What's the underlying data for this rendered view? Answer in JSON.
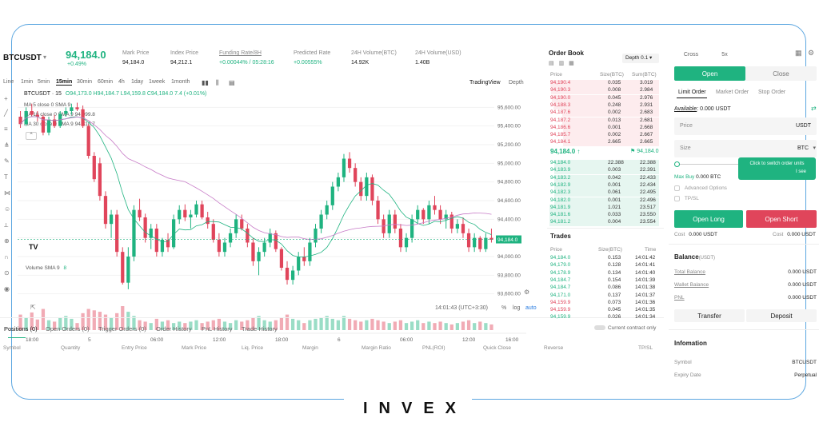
{
  "header": {
    "symbol": "BTCUSDT",
    "last_price": "94,184.0",
    "change_pct": "+0.49%",
    "stats": [
      {
        "label": "Mark Price",
        "value": "94,184.0"
      },
      {
        "label": "Index Price",
        "value": "94,212.1"
      },
      {
        "label": "Funding Rate/8H",
        "value": "+0.00044% / 05:28:16"
      },
      {
        "label": "Predicted Rate",
        "value": "+0.00555%"
      },
      {
        "label": "24H Volume(BTC)",
        "value": "14.92K"
      },
      {
        "label": "24H Volume(USD)",
        "value": "1.40B"
      }
    ]
  },
  "toolbar": {
    "intervals": [
      "Line",
      "1min",
      "5min",
      "15min",
      "30min",
      "60min",
      "4h",
      "1day",
      "1week",
      "1month"
    ],
    "active_interval": "15min",
    "view_tradingview": "TradingView",
    "view_depth": "Depth"
  },
  "chart": {
    "legend_main": "BTCUSDT · 15",
    "ohlc": "O94,173.0 H94,184.7 L94,159.8 C94,184.0 7.4 (+0.01%)",
    "ma_lines": [
      "MA 5 close 0 SMA 9",
      "MA 10 close 0 SMA 9  94,099.8",
      "MA 30 close 0 SMA 9  94,310.7"
    ],
    "price_ticks": [
      "95,600.00",
      "95,400.00",
      "95,200.00",
      "95,000.00",
      "94,800.00",
      "94,600.00",
      "94,400.00",
      "94,200.00",
      "94,000.00",
      "93,800.00",
      "93,600.00"
    ],
    "current_price_tag": "94,184.0",
    "time_ticks": [
      "18:00",
      "5",
      "06:00",
      "12:00",
      "18:00",
      "6",
      "06:00",
      "12:00",
      "16:00"
    ],
    "volume_label": "Volume SMA 9",
    "volume_value": "8",
    "clock": "14:01:43 (UTC+3:30)",
    "scale_pct": "%",
    "scale_log": "log",
    "scale_auto": "auto",
    "tv_logo": "TV",
    "colors": {
      "up": "#1fb380",
      "down": "#e0455b",
      "ma1": "#1fb380",
      "ma2": "#c77bc7"
    }
  },
  "bottom_tabs": {
    "tabs": [
      "Positions (0)",
      "Open Orders (0)",
      "Trigger Orders (0)",
      "Order History",
      "PnL History",
      "Trade History"
    ],
    "current_contract": "Current contract only",
    "columns": [
      "Symbol",
      "Quantity",
      "Entry Price",
      "Mark Price",
      "Liq. Price",
      "Margin",
      "Margin Ratio",
      "PNL(ROI)",
      "Quick Close",
      "Reverse",
      "TP/SL"
    ]
  },
  "order_book": {
    "title": "Order Book",
    "depth": "Depth 0.1",
    "headers": [
      "Price",
      "Size(BTC)",
      "Sum(BTC)"
    ],
    "asks": [
      [
        "94,190.4",
        "0.035",
        "3.019"
      ],
      [
        "94,190.3",
        "0.008",
        "2.984"
      ],
      [
        "94,190.0",
        "0.045",
        "2.976"
      ],
      [
        "94,188.3",
        "0.248",
        "2.931"
      ],
      [
        "94,187.6",
        "0.002",
        "2.683"
      ],
      [
        "94,187.2",
        "0.013",
        "2.681"
      ],
      [
        "94,186.6",
        "0.001",
        "2.668"
      ],
      [
        "94,185.7",
        "0.002",
        "2.667"
      ],
      [
        "94,184.1",
        "2.665",
        "2.665"
      ]
    ],
    "mid_price": "94,184.0 ↑",
    "mark_flag": "⚑ 94,184.0",
    "bids": [
      [
        "94,184.0",
        "22.388",
        "22.388"
      ],
      [
        "94,183.9",
        "0.003",
        "22.391"
      ],
      [
        "94,183.2",
        "0.042",
        "22.433"
      ],
      [
        "94,182.9",
        "0.001",
        "22.434"
      ],
      [
        "94,182.3",
        "0.061",
        "22.495"
      ],
      [
        "94,182.0",
        "0.001",
        "22.496"
      ],
      [
        "94,181.9",
        "1.021",
        "23.517"
      ],
      [
        "94,181.6",
        "0.033",
        "23.550"
      ],
      [
        "94,181.2",
        "0.004",
        "23.554"
      ]
    ]
  },
  "trades": {
    "title": "Trades",
    "headers": [
      "Price",
      "Size(BTC)",
      "Time"
    ],
    "rows": [
      [
        "94,184.0",
        "0.153",
        "14:01:42",
        "up"
      ],
      [
        "94,179.0",
        "0.128",
        "14:01:41",
        "up"
      ],
      [
        "94,178.9",
        "0.134",
        "14:01:40",
        "up"
      ],
      [
        "94,184.7",
        "0.154",
        "14:01:39",
        "up"
      ],
      [
        "94,184.7",
        "0.086",
        "14:01:38",
        "up"
      ],
      [
        "94,171.0",
        "0.137",
        "14:01:37",
        "up"
      ],
      [
        "94,159.9",
        "0.073",
        "14:01:36",
        "down"
      ],
      [
        "94,159.9",
        "0.045",
        "14:01:35",
        "down"
      ],
      [
        "94,159.9",
        "0.026",
        "14:01:34",
        "up"
      ]
    ]
  },
  "trade_panel": {
    "margin_mode": "Cross",
    "leverage": "5x",
    "tab_open": "Open",
    "tab_close": "Close",
    "order_types": [
      "Limit Order",
      "Market Order",
      "Stop Order"
    ],
    "available_label": "Available",
    "available_value": ": 0.000 USDT",
    "price_label": "Price",
    "price_unit": "USDT",
    "size_label": "Size",
    "size_unit": "BTC",
    "tooltip": "Click to switch order units",
    "tooltip_sub": "I see",
    "max_buy": "Max Buy",
    "max_buy_value": "0.000 BTC",
    "advanced_options": "Advanced Options",
    "tpsl": "TP/SL",
    "open_long": "Open Long",
    "open_short": "Open Short",
    "cost_label": "Cost",
    "cost_long": "0.000 USDT",
    "cost_short": "0.000 USDT",
    "colors": {
      "long": "#1fb380",
      "short": "#e0455b"
    }
  },
  "balance": {
    "title": "Balance",
    "unit": "(USDT)",
    "rows": [
      {
        "label": "Total Balance",
        "value": "0.000 USDT"
      },
      {
        "label": "Wallet Balance",
        "value": "0.000 USDT"
      },
      {
        "label": "PNL",
        "value": "0.000 USDT"
      }
    ],
    "transfer": "Transfer",
    "deposit": "Deposit"
  },
  "information": {
    "title": "Infomation",
    "rows": [
      {
        "label": "Symbol",
        "value": "BTCUSDT"
      },
      {
        "label": "Expiry Date",
        "value": "Perpetual"
      }
    ]
  },
  "brand": {
    "logo_text": "INVEX"
  },
  "candles": [
    [
      95500,
      95560,
      95380,
      95420
    ],
    [
      95420,
      95600,
      95400,
      95560
    ],
    [
      95560,
      95640,
      95500,
      95520
    ],
    [
      95520,
      95560,
      95450,
      95500
    ],
    [
      95500,
      95520,
      95300,
      95330
    ],
    [
      95330,
      95500,
      95300,
      95470
    ],
    [
      95470,
      95520,
      95380,
      95400
    ],
    [
      95400,
      95560,
      95380,
      95530
    ],
    [
      95530,
      95600,
      95500,
      95560
    ],
    [
      95560,
      95640,
      95520,
      95600
    ],
    [
      95600,
      95650,
      95560,
      95580
    ],
    [
      95580,
      95620,
      95380,
      95400
    ],
    [
      95400,
      95420,
      95050,
      95080
    ],
    [
      95080,
      95120,
      94800,
      94830
    ],
    [
      95000,
      95060,
      94600,
      94650
    ],
    [
      94650,
      94700,
      94300,
      94350
    ],
    [
      94350,
      94500,
      94200,
      94450
    ],
    [
      94450,
      94500,
      94000,
      94050
    ],
    [
      94050,
      94100,
      93700,
      93720
    ],
    [
      93720,
      94100,
      93650,
      94000
    ],
    [
      94000,
      94550,
      93950,
      94500
    ],
    [
      94500,
      94620,
      94380,
      94420
    ],
    [
      94420,
      94460,
      94150,
      94200
    ],
    [
      94200,
      94350,
      94080,
      94300
    ],
    [
      94300,
      94350,
      94000,
      94050
    ],
    [
      94050,
      94200,
      94000,
      94180
    ],
    [
      94180,
      94250,
      94050,
      94100
    ],
    [
      94100,
      94450,
      94080,
      94400
    ],
    [
      94400,
      94550,
      94350,
      94500
    ],
    [
      94500,
      94560,
      94380,
      94420
    ],
    [
      94420,
      94500,
      94300,
      94450
    ],
    [
      94450,
      94600,
      94420,
      94560
    ],
    [
      94560,
      94600,
      94400,
      94420
    ],
    [
      94420,
      94480,
      94300,
      94350
    ],
    [
      94350,
      94400,
      94150,
      94180
    ],
    [
      94180,
      94250,
      94000,
      94050
    ],
    [
      94050,
      94200,
      94000,
      94150
    ],
    [
      94150,
      94300,
      94100,
      94250
    ],
    [
      94250,
      94450,
      94200,
      94400
    ],
    [
      94400,
      94450,
      94280,
      94300
    ],
    [
      94300,
      94350,
      94100,
      94150
    ],
    [
      94150,
      94200,
      93900,
      93950
    ],
    [
      93950,
      94100,
      93800,
      94050
    ],
    [
      94050,
      94200,
      94000,
      94150
    ],
    [
      94150,
      94300,
      94100,
      94250
    ],
    [
      94250,
      94280,
      94050,
      94080
    ],
    [
      94080,
      94100,
      93850,
      93880
    ],
    [
      93880,
      93950,
      93700,
      93750
    ],
    [
      93750,
      93900,
      93700,
      93850
    ],
    [
      93850,
      94050,
      93800,
      94000
    ],
    [
      94000,
      94100,
      93900,
      93950
    ],
    [
      93950,
      94200,
      93900,
      94150
    ],
    [
      94150,
      94350,
      94100,
      94300
    ],
    [
      94300,
      94500,
      94250,
      94450
    ],
    [
      94450,
      94600,
      94400,
      94550
    ],
    [
      94550,
      94800,
      94500,
      94750
    ],
    [
      94750,
      94900,
      94700,
      94850
    ],
    [
      94850,
      95100,
      94800,
      95050
    ],
    [
      95050,
      95120,
      94900,
      94950
    ],
    [
      94950,
      95000,
      94750,
      94800
    ],
    [
      94800,
      94850,
      94600,
      94650
    ],
    [
      94650,
      94900,
      94600,
      94850
    ],
    [
      94850,
      94880,
      94550,
      94600
    ],
    [
      94600,
      94650,
      94350,
      94400
    ],
    [
      94400,
      94450,
      94200,
      94250
    ],
    [
      94250,
      94500,
      94200,
      94450
    ],
    [
      94450,
      94500,
      94250,
      94300
    ],
    [
      94300,
      94350,
      94050,
      94100
    ],
    [
      94100,
      94250,
      94050,
      94200
    ],
    [
      94200,
      94450,
      94150,
      94400
    ],
    [
      94400,
      94550,
      94350,
      94500
    ],
    [
      94500,
      94520,
      94350,
      94400
    ],
    [
      94400,
      94600,
      94350,
      94550
    ],
    [
      94550,
      94650,
      94450,
      94500
    ],
    [
      94500,
      94550,
      94350,
      94400
    ],
    [
      94400,
      94500,
      94300,
      94450
    ],
    [
      94450,
      94480,
      94250,
      94300
    ],
    [
      94300,
      94400,
      94250,
      94350
    ],
    [
      94350,
      94420,
      94200,
      94250
    ],
    [
      94250,
      94300,
      94050,
      94100
    ],
    [
      94100,
      94250,
      94050,
      94200
    ],
    [
      94200,
      94220,
      94050,
      94080
    ],
    [
      94080,
      94250,
      94050,
      94200
    ],
    [
      94200,
      94300,
      94150,
      94180
    ]
  ],
  "volumes": [
    22,
    18,
    25,
    15,
    30,
    14,
    12,
    18,
    20,
    16,
    10,
    24,
    30,
    28,
    26,
    22,
    18,
    24,
    34,
    26,
    20,
    14,
    12,
    10,
    16,
    12,
    14,
    10,
    12,
    10,
    12,
    14,
    10,
    12,
    14,
    16,
    12,
    10,
    14,
    12,
    14,
    18,
    20,
    14,
    12,
    14,
    18,
    22,
    16,
    14,
    10,
    14,
    16,
    18,
    20,
    16,
    14,
    20,
    16,
    14,
    12,
    14,
    16,
    14,
    12,
    10,
    12,
    14,
    10,
    12,
    14,
    10,
    12,
    10,
    12,
    10,
    8,
    10,
    12,
    14,
    10,
    12,
    10,
    8
  ]
}
